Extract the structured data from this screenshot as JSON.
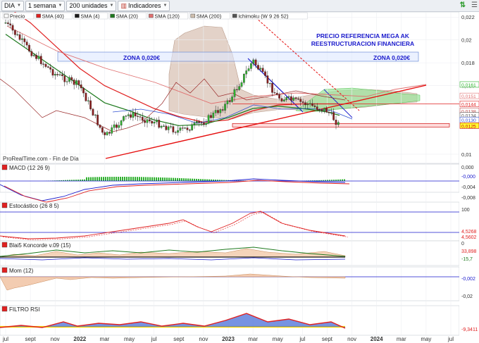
{
  "toolbar": {
    "ticker": "DIA",
    "timeframe": "1 semana",
    "units": "200 unidades",
    "indicators": "Indicadores"
  },
  "legend": [
    "Precio",
    "SMA (40)",
    "SMA (4)",
    "SMA (20)",
    "SMA (120)",
    "SMA (200)",
    "Ichimoku (W 9 26 52)"
  ],
  "legend_colors": [
    "#ffffff",
    "#e02020",
    "#1a1a1a",
    "#1f7a1f",
    "#e07070",
    "#d0c0b0",
    "#555555"
  ],
  "annotations": {
    "title_line1": "PRECIO REFERENCIA MEGA AK",
    "title_line2": "REESTRUCTURACION FINANCIERA",
    "zone_left": "ZONA 0,020€",
    "zone_right": "ZONA 0,020€",
    "source": "ProRealTime.com - Fin de Día"
  },
  "price_axis": {
    "ticks": [
      "0,022",
      "0,02",
      "0,018",
      "0,016",
      "0,01"
    ],
    "value_labels": [
      "0,0161",
      "0,0151",
      "0,0144",
      "0,0138",
      "0,0134",
      "0,0130",
      "0,0125"
    ],
    "value_colors": [
      "#2bb32b",
      "#e07070",
      "#e02020",
      "#c05050",
      "#555555",
      "#3050d0",
      "#cc0000"
    ]
  },
  "x_axis": {
    "ticks": [
      "jul",
      "sept",
      "nov",
      "2022",
      "mar",
      "may",
      "jul",
      "sept",
      "nov",
      "2023",
      "mar",
      "may",
      "jul",
      "sept",
      "nov",
      "2024",
      "mar",
      "may",
      "jul"
    ]
  },
  "panels": {
    "macd": {
      "label": "MACD (12 26 9)",
      "ticks": [
        "0,000",
        "-0,000",
        "-0,004",
        "-0,008"
      ]
    },
    "stoch": {
      "label": "Estocástico (26 8 5)",
      "ticks": [
        "100",
        "4,5268",
        "4,5602",
        "0"
      ]
    },
    "koncorde": {
      "label": "Blai5 Koncorde v.09 (15)",
      "ticks": [
        "33,898",
        "-15,7"
      ]
    },
    "mom": {
      "label": "Mom (12)",
      "ticks": [
        "-0,002",
        "-0,02"
      ]
    },
    "rsi": {
      "label": "FILTRO RSI",
      "ticks": [
        "-9,3411"
      ]
    }
  },
  "chart_data": {
    "type": "line",
    "title": "DIA",
    "timeframe": "weekly",
    "x": [
      "2021-07",
      "2021-09",
      "2021-11",
      "2022-01",
      "2022-03",
      "2022-05",
      "2022-07",
      "2022-09",
      "2022-11",
      "2023-01",
      "2023-03",
      "2023-05",
      "2023-07",
      "2023-09",
      "2023-10"
    ],
    "series": [
      {
        "name": "Precio",
        "values": [
          0.0215,
          0.019,
          0.017,
          0.016,
          0.0115,
          0.0135,
          0.0128,
          0.012,
          0.0128,
          0.0145,
          0.0182,
          0.015,
          0.0145,
          0.0138,
          0.0125
        ]
      },
      {
        "name": "SMA (40)",
        "values": [
          0.023,
          0.0215,
          0.0195,
          0.0175,
          0.016,
          0.015,
          0.014,
          0.0133,
          0.0128,
          0.013,
          0.0138,
          0.0143,
          0.0144,
          0.0144,
          0.0144
        ]
      },
      {
        "name": "SMA (20)",
        "values": [
          0.0205,
          0.019,
          0.0175,
          0.016,
          0.0145,
          0.0138,
          0.013,
          0.0125,
          0.0126,
          0.0132,
          0.014,
          0.0142,
          0.014,
          0.0137,
          0.0134
        ]
      }
    ],
    "ylim": [
      0.0095,
      0.0222
    ],
    "levels": [
      0.0144,
      0.0125
    ],
    "zone": 0.02
  }
}
